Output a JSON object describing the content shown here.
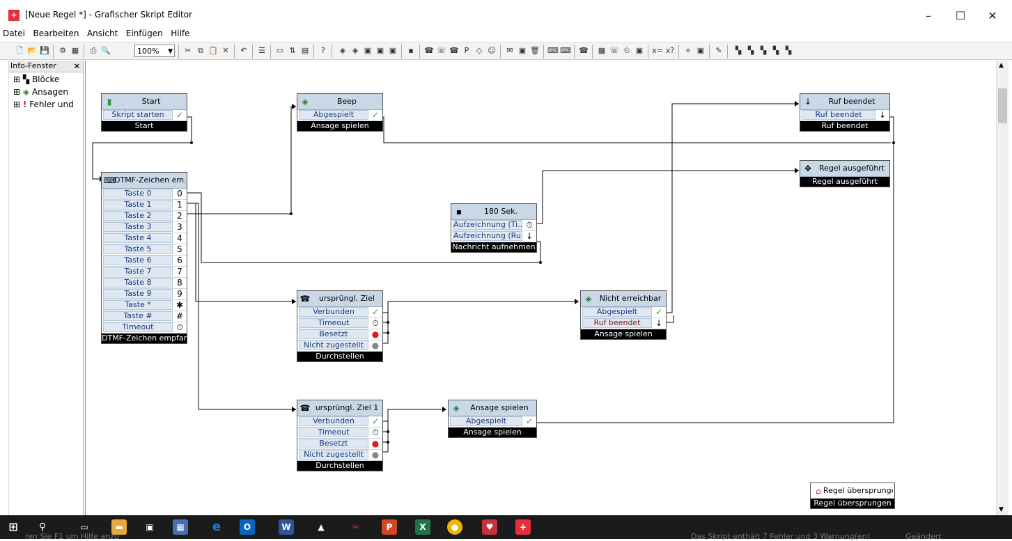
{
  "window": {
    "title": "[Neue Regel *] - Grafischer Skript Editor",
    "minimize": "–",
    "maximize": "☐",
    "close": "✕"
  },
  "menu": [
    "Datei",
    "Bearbeiten",
    "Ansicht",
    "Einfügen",
    "Hilfe"
  ],
  "toolbar": {
    "zoom": "100%"
  },
  "info_panel": {
    "title": "Info-Fenster",
    "close": "×",
    "items": [
      {
        "expander": "⊞",
        "label": "Blöcke"
      },
      {
        "expander": "⊞",
        "label": "Ansagen"
      },
      {
        "expander": "⊞",
        "label": "Fehler und"
      }
    ]
  },
  "blocks": {
    "start": {
      "title": "Start",
      "rows": [
        {
          "label": "Skript starten",
          "icon": "✓"
        }
      ],
      "footer": "Start"
    },
    "beep": {
      "title": "Beep",
      "rows": [
        {
          "label": "Abgespielt",
          "icon": "✓"
        }
      ],
      "footer": "Ansage spielen"
    },
    "ruf_beendet": {
      "title": "Ruf beendet",
      "rows": [
        {
          "label": "Ruf beendet",
          "icon": "↓"
        }
      ],
      "footer": "Ruf beendet"
    },
    "regel_ausgefuehrt": {
      "title": "Regel ausgeführt",
      "footer": "Regel ausgeführt"
    },
    "dtmf": {
      "title": "DTMF-Zeichen em...",
      "rows": [
        {
          "label": "Taste 0",
          "icon": "0"
        },
        {
          "label": "Taste 1",
          "icon": "1"
        },
        {
          "label": "Taste 2",
          "icon": "2"
        },
        {
          "label": "Taste 3",
          "icon": "3"
        },
        {
          "label": "Taste 4",
          "icon": "4"
        },
        {
          "label": "Taste 5",
          "icon": "5"
        },
        {
          "label": "Taste 6",
          "icon": "6"
        },
        {
          "label": "Taste 7",
          "icon": "7"
        },
        {
          "label": "Taste 8",
          "icon": "8"
        },
        {
          "label": "Taste 9",
          "icon": "9"
        },
        {
          "label": "Taste *",
          "icon": "✱"
        },
        {
          "label": "Taste #",
          "icon": "#"
        },
        {
          "label": "Timeout",
          "icon": "⏱"
        }
      ],
      "footer": "DTMF-Zeichen empfan..."
    },
    "rec180": {
      "title": "180 Sek.",
      "rows": [
        {
          "label": "Aufzeichnung (Ti...",
          "icon": "⏱"
        },
        {
          "label": "Aufzeichnung (Ru...",
          "icon": "↓"
        }
      ],
      "footer": "Nachricht aufnehmen"
    },
    "ziel": {
      "title": "ursprüngl. Ziel",
      "rows": [
        {
          "label": "Verbunden",
          "icon": "✓"
        },
        {
          "label": "Timeout",
          "icon": "⏱"
        },
        {
          "label": "Besetzt",
          "icon": "●"
        },
        {
          "label": "Nicht zugestellt",
          "icon": "●"
        }
      ],
      "footer": "Durchstellen"
    },
    "nicht_erreichbar": {
      "title": "Nicht erreichbar",
      "rows": [
        {
          "label": "Abgespielt",
          "icon": "✓"
        },
        {
          "label": "Ruf beendet",
          "icon": "↓"
        }
      ],
      "footer": "Ansage spielen"
    },
    "ziel1": {
      "title": "ursprüngl. Ziel 1",
      "rows": [
        {
          "label": "Verbunden",
          "icon": "✓"
        },
        {
          "label": "Timeout",
          "icon": "⏱"
        },
        {
          "label": "Besetzt",
          "icon": "●"
        },
        {
          "label": "Nicht zugestellt",
          "icon": "●"
        }
      ],
      "footer": "Durchstellen"
    },
    "ansage_spielen": {
      "title": "Ansage spielen",
      "rows": [
        {
          "label": "Abgespielt",
          "icon": "✓"
        }
      ],
      "footer": "Ansage spielen"
    },
    "regel_uebersprungen": {
      "title": "Regel übersprungen",
      "footer": "Regel übersprungen"
    }
  },
  "statusbar": {
    "left": "ren Sie F1 um Hilfe anzu",
    "middle": "Das Skript enthält 7 Fehler und 3 Warnung(en)",
    "right": "Geändert"
  },
  "colors": {
    "block_header": "#c9d8e7",
    "row_fill": "#dfe8f2",
    "check_green": "#2a9d2a",
    "busy_red": "#d9201f",
    "taskbar": "#1b1b1b"
  }
}
